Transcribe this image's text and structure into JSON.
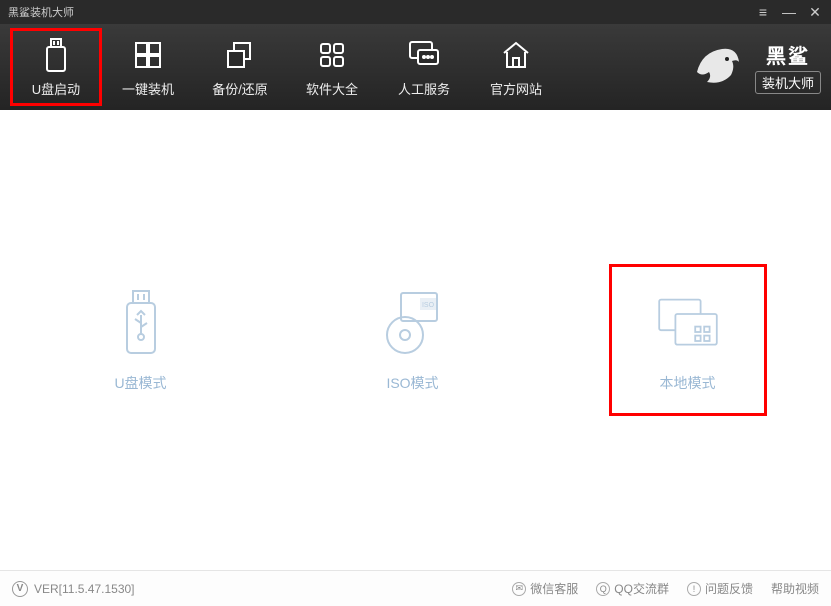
{
  "titlebar": {
    "title": "黑鲨装机大师"
  },
  "nav": {
    "items": [
      {
        "label": "U盘启动",
        "icon": "usb-icon",
        "highlighted": true
      },
      {
        "label": "一键装机",
        "icon": "windows-icon",
        "highlighted": false
      },
      {
        "label": "备份/还原",
        "icon": "copy-icon",
        "highlighted": false
      },
      {
        "label": "软件大全",
        "icon": "apps-icon",
        "highlighted": false
      },
      {
        "label": "人工服务",
        "icon": "chat-icon",
        "highlighted": false
      },
      {
        "label": "官方网站",
        "icon": "home-icon",
        "highlighted": false
      }
    ]
  },
  "brand": {
    "name": "黑鲨",
    "subtitle": "装机大师"
  },
  "modes": [
    {
      "label": "U盘模式",
      "icon": "usb-mode-icon",
      "highlighted": false
    },
    {
      "label": "ISO模式",
      "icon": "iso-mode-icon",
      "highlighted": false
    },
    {
      "label": "本地模式",
      "icon": "local-mode-icon",
      "highlighted": true
    }
  ],
  "footer": {
    "version": "VER[11.5.47.1530]",
    "links": [
      {
        "label": "微信客服"
      },
      {
        "label": "QQ交流群"
      },
      {
        "label": "问题反馈"
      },
      {
        "label": "帮助视频"
      }
    ]
  }
}
